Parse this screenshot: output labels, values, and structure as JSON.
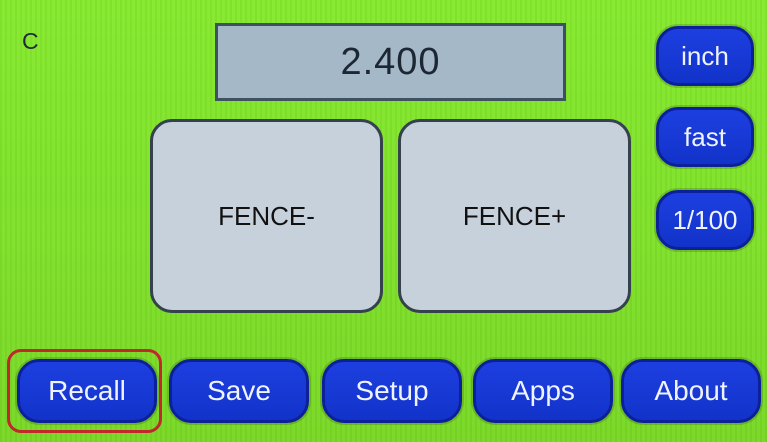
{
  "status": {
    "mode_letter": "C"
  },
  "readout": {
    "value": "2.400"
  },
  "jog": {
    "minus_label": "FENCE-",
    "plus_label": "FENCE+"
  },
  "side_buttons": {
    "units_label": "inch",
    "speed_label": "fast",
    "resolution_label": "1/100"
  },
  "bottom_nav": {
    "recall_label": "Recall",
    "save_label": "Save",
    "setup_label": "Setup",
    "apps_label": "Apps",
    "about_label": "About"
  },
  "colors": {
    "background": "#7fe12a",
    "button_blue": "#1437d2",
    "panel_gray": "#c7d1dc",
    "readout_gray": "#a5b8c8",
    "highlight_red": "#c0282c"
  }
}
